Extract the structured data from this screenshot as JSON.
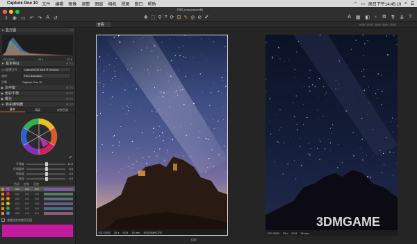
{
  "menubar": {
    "app": "Capture One 10",
    "items": [
      "文件",
      "编辑",
      "图像",
      "调整",
      "图层",
      "相机",
      "视图",
      "窗口",
      "帮助"
    ],
    "time": "周日下午14:45:19"
  },
  "window": {
    "title": "NW.cosessiondb",
    "colors": {
      "close": "#fc5f57",
      "min": "#fdbc2e",
      "max": "#28c840"
    }
  },
  "viewer_tab": "查看",
  "left_panel": {
    "histogram": {
      "title": "直方图",
      "iso": "ISO 3200",
      "shutter": "25 s",
      "aperture": "f/2.8"
    },
    "basic": {
      "title": "基本特征",
      "rows": [
        {
          "key": "ICC配置文件",
          "value": "Canon EOS 5DS R Generic"
        },
        {
          "key": "曲线",
          "value": "Film Standard"
        },
        {
          "key": "引擎",
          "value": "Capture One 10"
        }
      ]
    },
    "sections": [
      "白平衡",
      "色彩平衡",
      "曝光",
      "色彩编辑器"
    ],
    "subtabs": [
      "基本",
      "高级",
      "皮肤色调"
    ],
    "sliders": [
      {
        "label": "平滑度",
        "value": "12.9",
        "pos": 0.5
      },
      {
        "label": "色调旋转",
        "value": "0.0",
        "pos": 0.5
      },
      {
        "label": "饱和度",
        "value": "0.0",
        "pos": 0.5
      },
      {
        "label": "亮度",
        "value": "0.0",
        "pos": 0.5
      }
    ],
    "color_table": {
      "headers": [
        "色调",
        "饱和",
        "亮度"
      ],
      "rows": [
        {
          "color": "#b43fe0",
          "a": "0.0",
          "b": "0.0",
          "c": "0.0",
          "bar": "#7a5aa8"
        },
        {
          "color": "#d12b2b",
          "a": "0.0",
          "b": "0.0",
          "c": "0.0",
          "bar": "#5c7a5c"
        },
        {
          "color": "#e08a1c",
          "a": "0.0",
          "b": "0.0",
          "c": "0.0",
          "bar": "#556e8a"
        },
        {
          "color": "#d9c024",
          "a": "0.0",
          "b": "0.0",
          "c": "0.0",
          "bar": "#6a5b7a"
        },
        {
          "color": "#38a838",
          "a": "0.0",
          "b": "0.0",
          "c": "0.0",
          "bar": "#4d6a8a"
        },
        {
          "color": "#3a86d9",
          "a": "0.0",
          "b": "0.0",
          "c": "0.0",
          "bar": "#8a5b6e"
        }
      ]
    },
    "view_selected": "查看选定的颜色范围"
  },
  "photo1": {
    "info": [
      "ISO 3200",
      "25 s",
      "f/2.8",
      "16 mm",
      "50153669.CR2"
    ]
  },
  "photo2": {
    "info": [
      "ISO 3200",
      "25 s",
      "f/2.8",
      "16 mm"
    ]
  },
  "bottom_label": "ΩΩ",
  "watermark": "3DMGAME"
}
